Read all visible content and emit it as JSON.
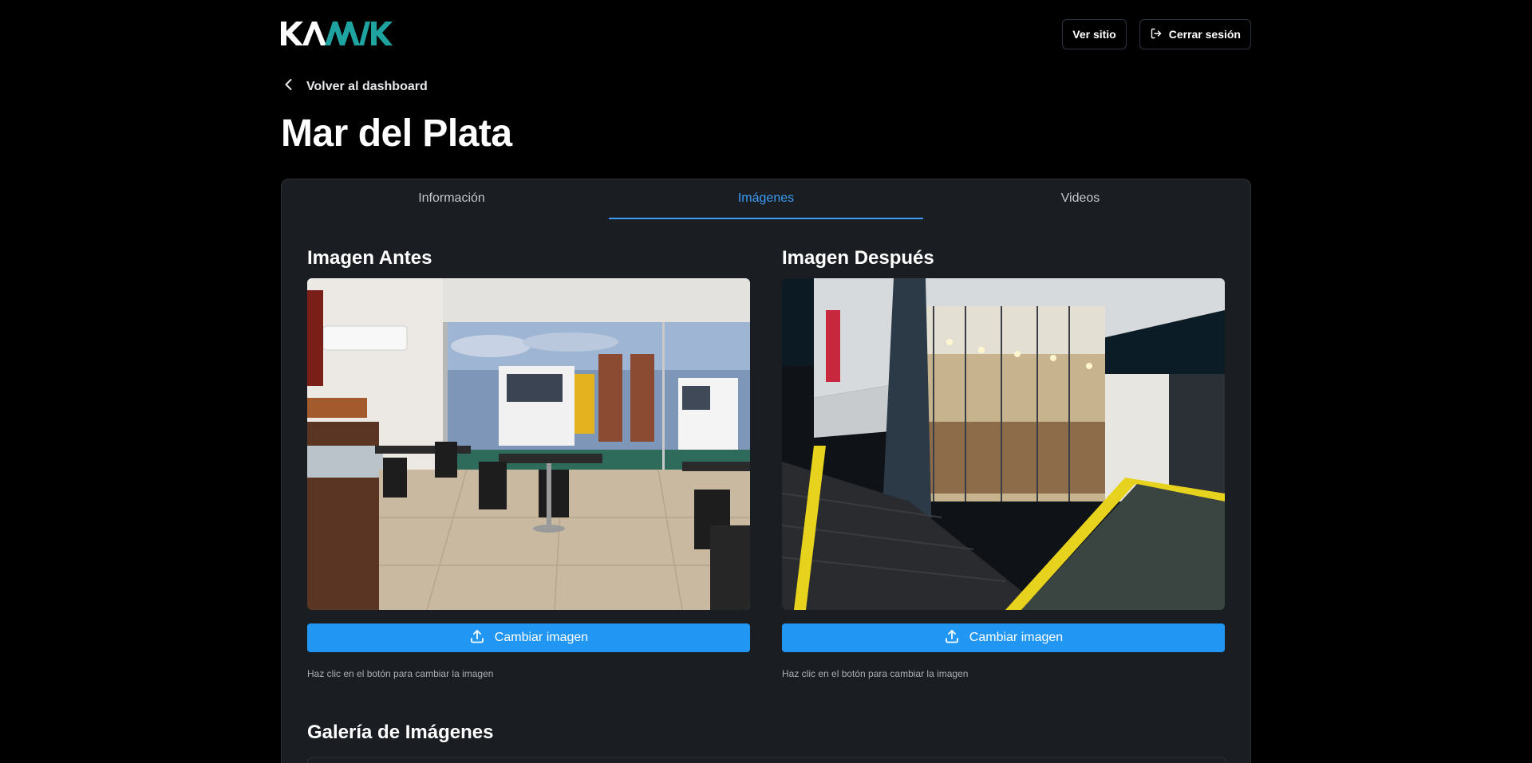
{
  "header": {
    "logo_text": "KAMAK",
    "view_site_label": "Ver sitio",
    "logout_label": "Cerrar sesión"
  },
  "back_link": {
    "label": "Volver al dashboard"
  },
  "page_title": "Mar del Plata",
  "tabs": [
    {
      "label": "Información",
      "active": false
    },
    {
      "label": "Imágenes",
      "active": true
    },
    {
      "label": "Videos",
      "active": false
    }
  ],
  "images": {
    "before": {
      "title": "Imagen Antes",
      "button_label": "Cambiar imagen",
      "hint": "Haz clic en el botón para cambiar la imagen"
    },
    "after": {
      "title": "Imagen Después",
      "button_label": "Cambiar imagen",
      "hint": "Haz clic en el botón para cambiar la imagen"
    }
  },
  "gallery": {
    "title": "Galería de Imágenes"
  },
  "colors": {
    "accent": "#2196f3",
    "tab_active": "#3b9cf5",
    "card_bg": "#1a1d22",
    "logo_teal": "#1fa3a0"
  }
}
